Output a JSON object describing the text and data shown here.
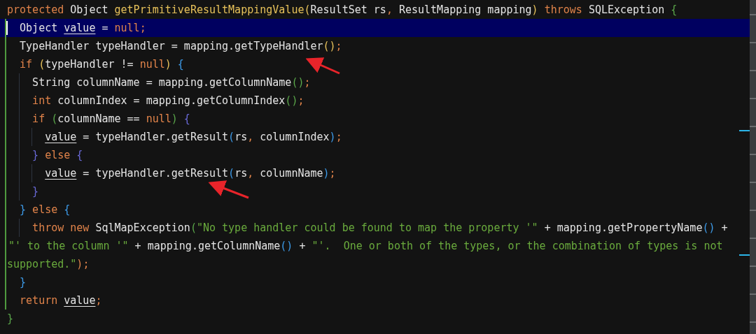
{
  "editor": {
    "lines": [
      {
        "kind": "code",
        "current": false,
        "changed": false,
        "tokens": [
          {
            "text": "protected ",
            "kind": "keyword"
          },
          {
            "text": "Object ",
            "kind": "plain"
          },
          {
            "text": "getPrimitiveResultMappingValue",
            "kind": "method"
          },
          {
            "text": "(",
            "kind": "bracket",
            "color": "#e6c15a"
          },
          {
            "text": "ResultSet rs",
            "kind": "plain"
          },
          {
            "text": ", ",
            "kind": "punct"
          },
          {
            "text": "ResultMapping mapping",
            "kind": "plain"
          },
          {
            "text": ")",
            "kind": "bracket",
            "color": "#e6c15a"
          },
          {
            "text": " throws ",
            "kind": "keyword"
          },
          {
            "text": "SQLException ",
            "kind": "plain"
          },
          {
            "text": "{",
            "kind": "bracket",
            "color": "#5aa64a"
          }
        ]
      },
      {
        "kind": "code",
        "current": true,
        "changed": true,
        "tokens": [
          {
            "text": "  Object ",
            "kind": "plain"
          },
          {
            "text": "value",
            "kind": "variable"
          },
          {
            "text": " = ",
            "kind": "plain"
          },
          {
            "text": "null",
            "kind": "keyword"
          },
          {
            "text": ";",
            "kind": "punct"
          }
        ]
      },
      {
        "kind": "code",
        "current": false,
        "changed": true,
        "tokens": [
          {
            "text": "  TypeHandler typeHandler = mapping.getTypeHandler",
            "kind": "plain"
          },
          {
            "text": "()",
            "kind": "bracket",
            "color": "#e6c15a"
          },
          {
            "text": ";",
            "kind": "punct"
          }
        ]
      },
      {
        "kind": "code",
        "current": false,
        "changed": true,
        "tokens": [
          {
            "text": "  if ",
            "kind": "keyword"
          },
          {
            "text": "(",
            "kind": "bracket",
            "color": "#e6c15a"
          },
          {
            "text": "typeHandler != ",
            "kind": "plain"
          },
          {
            "text": "null",
            "kind": "keyword"
          },
          {
            "text": ")",
            "kind": "bracket",
            "color": "#e6c15a"
          },
          {
            "text": " {",
            "kind": "bracket",
            "color": "#3d9be9"
          }
        ]
      },
      {
        "kind": "code",
        "current": false,
        "changed": true,
        "tokens": [
          {
            "text": "    String columnName = mapping.getColumnName",
            "kind": "plain"
          },
          {
            "text": "()",
            "kind": "bracket",
            "color": "#5aa64a"
          },
          {
            "text": ";",
            "kind": "punct"
          }
        ]
      },
      {
        "kind": "code",
        "current": false,
        "changed": true,
        "tokens": [
          {
            "text": "    int ",
            "kind": "keyword"
          },
          {
            "text": "columnIndex = mapping.getColumnIndex",
            "kind": "plain"
          },
          {
            "text": "()",
            "kind": "bracket",
            "color": "#5aa64a"
          },
          {
            "text": ";",
            "kind": "punct"
          }
        ]
      },
      {
        "kind": "code",
        "current": false,
        "changed": true,
        "tokens": [
          {
            "text": "    if ",
            "kind": "keyword"
          },
          {
            "text": "(",
            "kind": "bracket",
            "color": "#5aa64a"
          },
          {
            "text": "columnName == ",
            "kind": "plain"
          },
          {
            "text": "null",
            "kind": "keyword"
          },
          {
            "text": ")",
            "kind": "bracket",
            "color": "#5aa64a"
          },
          {
            "text": " {",
            "kind": "bracket",
            "color": "#6a6ad8"
          }
        ]
      },
      {
        "kind": "code",
        "current": false,
        "changed": true,
        "tokens": [
          {
            "text": "      value",
            "kind": "variable"
          },
          {
            "text": " = typeHandler.getResult",
            "kind": "plain"
          },
          {
            "text": "(",
            "kind": "bracket",
            "color": "#3d9be9"
          },
          {
            "text": "rs",
            "kind": "plain"
          },
          {
            "text": ", ",
            "kind": "punct"
          },
          {
            "text": "columnIndex",
            "kind": "plain"
          },
          {
            "text": ")",
            "kind": "bracket",
            "color": "#3d9be9"
          },
          {
            "text": ";",
            "kind": "punct"
          }
        ]
      },
      {
        "kind": "code",
        "current": false,
        "changed": true,
        "tokens": [
          {
            "text": "    }",
            "kind": "bracket",
            "color": "#6a6ad8"
          },
          {
            "text": " else ",
            "kind": "keyword"
          },
          {
            "text": "{",
            "kind": "bracket",
            "color": "#6a6ad8"
          }
        ]
      },
      {
        "kind": "code",
        "current": false,
        "changed": true,
        "tokens": [
          {
            "text": "      value",
            "kind": "variable"
          },
          {
            "text": " = typeHandler.getResult",
            "kind": "plain"
          },
          {
            "text": "(",
            "kind": "bracket",
            "color": "#3d9be9"
          },
          {
            "text": "rs",
            "kind": "plain"
          },
          {
            "text": ", ",
            "kind": "punct"
          },
          {
            "text": "columnName",
            "kind": "plain"
          },
          {
            "text": ")",
            "kind": "bracket",
            "color": "#3d9be9"
          },
          {
            "text": ";",
            "kind": "punct"
          }
        ]
      },
      {
        "kind": "code",
        "current": false,
        "changed": true,
        "tokens": [
          {
            "text": "    }",
            "kind": "bracket",
            "color": "#6a6ad8"
          }
        ]
      },
      {
        "kind": "code",
        "current": false,
        "changed": true,
        "tokens": [
          {
            "text": "  }",
            "kind": "bracket",
            "color": "#3d9be9"
          },
          {
            "text": " else ",
            "kind": "keyword"
          },
          {
            "text": "{",
            "kind": "bracket",
            "color": "#3d9be9"
          }
        ]
      },
      {
        "kind": "code",
        "current": false,
        "changed": true,
        "tokens": [
          {
            "text": "    throw new ",
            "kind": "keyword"
          },
          {
            "text": "SqlMapException",
            "kind": "plain"
          },
          {
            "text": "(",
            "kind": "bracket",
            "color": "#5aa64a"
          },
          {
            "text": "\"No type handler could be found to map the property '\"",
            "kind": "string"
          },
          {
            "text": " + mapping.getPropertyName",
            "kind": "plain"
          },
          {
            "text": "()",
            "kind": "bracket",
            "color": "#3d9be9"
          },
          {
            "text": " +",
            "kind": "plain"
          }
        ]
      },
      {
        "kind": "continuation",
        "current": false,
        "changed": true,
        "tokens": [
          {
            "text": "\"' to the column '\"",
            "kind": "string"
          },
          {
            "text": " + mapping.getColumnName",
            "kind": "plain"
          },
          {
            "text": "()",
            "kind": "bracket",
            "color": "#3d9be9"
          },
          {
            "text": " + ",
            "kind": "plain"
          },
          {
            "text": "\"'.  One or both of the types, or the combination of types is not",
            "kind": "string"
          }
        ]
      },
      {
        "kind": "wrap",
        "current": false,
        "changed": true,
        "tokens": [
          {
            "text": "supported.\"",
            "kind": "string"
          },
          {
            "text": ")",
            "kind": "bracket",
            "color": "#e0834a"
          },
          {
            "text": ";",
            "kind": "punct"
          }
        ]
      },
      {
        "kind": "code",
        "current": false,
        "changed": true,
        "tokens": [
          {
            "text": "  }",
            "kind": "bracket",
            "color": "#3d9be9"
          }
        ]
      },
      {
        "kind": "code",
        "current": false,
        "changed": true,
        "tokens": [
          {
            "text": "  return ",
            "kind": "keyword"
          },
          {
            "text": "value",
            "kind": "variable"
          },
          {
            "text": ";",
            "kind": "punct"
          }
        ]
      },
      {
        "kind": "code",
        "current": false,
        "changed": false,
        "tokens": [
          {
            "text": "}",
            "kind": "bracket",
            "color": "#5aa64a"
          }
        ]
      }
    ]
  }
}
